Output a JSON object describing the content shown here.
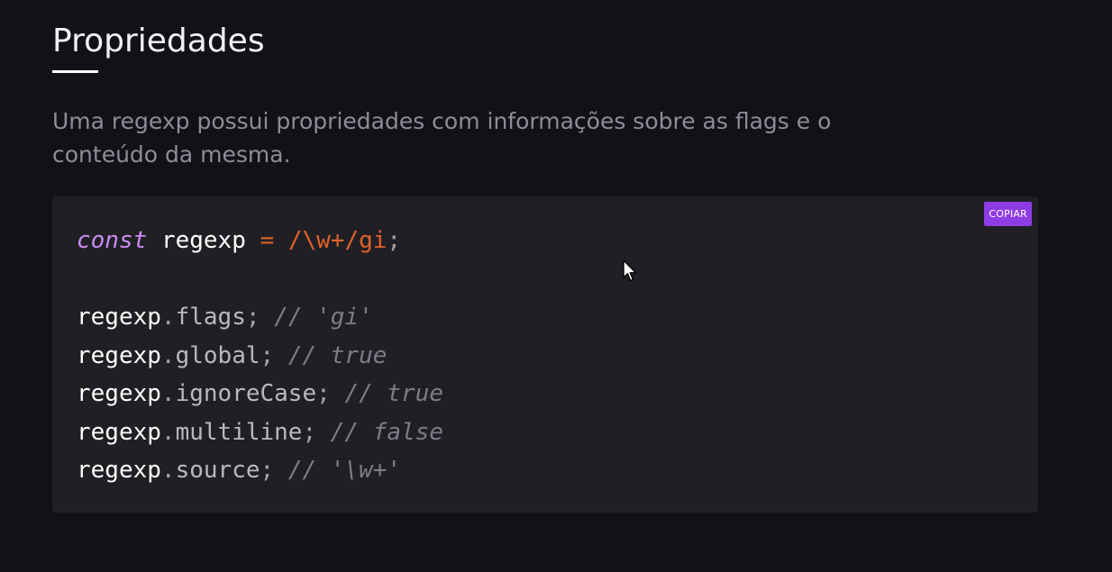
{
  "section": {
    "title": "Propriedades",
    "description": "Uma regexp possui propriedades com informações sobre as flags e o conteúdo da mesma."
  },
  "code_block": {
    "copy_label": "COPIAR",
    "lines": [
      {
        "kw": "const",
        "ident": "regexp",
        "op": "=",
        "regex": "/\\w+/gi",
        "punc": ";"
      },
      {},
      {
        "obj": "regexp",
        "dot": ".",
        "prop": "flags",
        "punc": ";",
        "comment": "// 'gi'"
      },
      {
        "obj": "regexp",
        "dot": ".",
        "prop": "global",
        "punc": ";",
        "comment": "// true"
      },
      {
        "obj": "regexp",
        "dot": ".",
        "prop": "ignoreCase",
        "punc": ";",
        "comment": "// true"
      },
      {
        "obj": "regexp",
        "dot": ".",
        "prop": "multiline",
        "punc": ";",
        "comment": "// false"
      },
      {
        "obj": "regexp",
        "dot": ".",
        "prop": "source",
        "punc": ";",
        "comment": "// '\\w+'"
      }
    ]
  },
  "colors": {
    "background": "#111117",
    "code_background": "#202024",
    "accent": "#8e3ce6",
    "keyword": "#c98bf3",
    "regex": "#e0622a",
    "comment": "#7c7c8a"
  },
  "icons": {
    "cursor": "mouse-pointer-icon"
  }
}
